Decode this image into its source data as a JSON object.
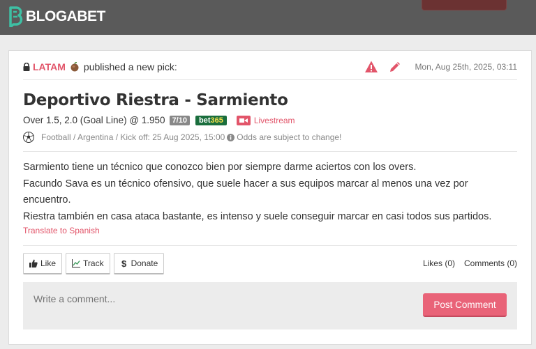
{
  "header": {
    "logo_text": "BLOGABET"
  },
  "post": {
    "user": "LATAM",
    "published_text": "published a new pick:",
    "date": "Mon, Aug 25th, 2025, 03:11",
    "title": "Deportivo Riestra - Sarmiento",
    "pick": "Over 1.5, 2.0 (Goal Line) @ 1.950",
    "stake": "7/10",
    "bookmaker_a": "bet",
    "bookmaker_b": "365",
    "livestream": "Livestream",
    "meta": "Football / Argentina / Kick off: 25 Aug 2025, 15:00",
    "odds_note": "Odds are subject to change!",
    "analysis": [
      "Sarmiento tiene un técnico que conozco bien por siempre darme aciertos con los overs.",
      "Facundo Sava es un técnico ofensivo, que suele hacer a sus equipos marcar al menos una vez por encuentro.",
      "Riestra también en casa ataca bastante, es intenso y suele conseguir marcar en casi todos sus partidos."
    ],
    "translate": "Translate to Spanish"
  },
  "actions": {
    "like": "Like",
    "track": "Track",
    "donate": "Donate",
    "likes": "Likes (0)",
    "comments": "Comments (0)"
  },
  "comment": {
    "placeholder": "Write a comment...",
    "post_label": "Post Comment"
  },
  "colors": {
    "accent": "#e2556a",
    "bookmaker_green": "#1a6e3d",
    "topbar": "#5a5a5a"
  }
}
